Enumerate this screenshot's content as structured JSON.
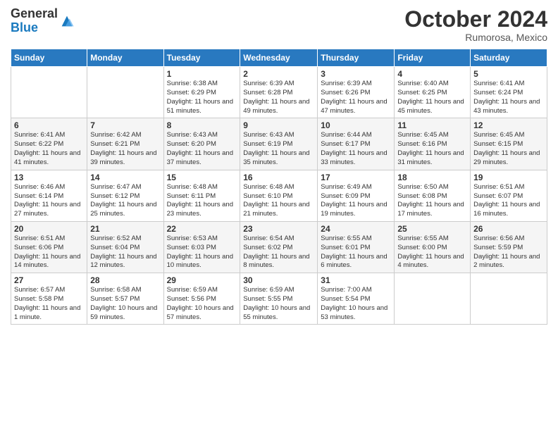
{
  "logo": {
    "general": "General",
    "blue": "Blue"
  },
  "title": "October 2024",
  "subtitle": "Rumorosa, Mexico",
  "days_of_week": [
    "Sunday",
    "Monday",
    "Tuesday",
    "Wednesday",
    "Thursday",
    "Friday",
    "Saturday"
  ],
  "weeks": [
    [
      {
        "day": "",
        "info": ""
      },
      {
        "day": "",
        "info": ""
      },
      {
        "day": "1",
        "info": "Sunrise: 6:38 AM\nSunset: 6:29 PM\nDaylight: 11 hours and 51 minutes."
      },
      {
        "day": "2",
        "info": "Sunrise: 6:39 AM\nSunset: 6:28 PM\nDaylight: 11 hours and 49 minutes."
      },
      {
        "day": "3",
        "info": "Sunrise: 6:39 AM\nSunset: 6:26 PM\nDaylight: 11 hours and 47 minutes."
      },
      {
        "day": "4",
        "info": "Sunrise: 6:40 AM\nSunset: 6:25 PM\nDaylight: 11 hours and 45 minutes."
      },
      {
        "day": "5",
        "info": "Sunrise: 6:41 AM\nSunset: 6:24 PM\nDaylight: 11 hours and 43 minutes."
      }
    ],
    [
      {
        "day": "6",
        "info": "Sunrise: 6:41 AM\nSunset: 6:22 PM\nDaylight: 11 hours and 41 minutes."
      },
      {
        "day": "7",
        "info": "Sunrise: 6:42 AM\nSunset: 6:21 PM\nDaylight: 11 hours and 39 minutes."
      },
      {
        "day": "8",
        "info": "Sunrise: 6:43 AM\nSunset: 6:20 PM\nDaylight: 11 hours and 37 minutes."
      },
      {
        "day": "9",
        "info": "Sunrise: 6:43 AM\nSunset: 6:19 PM\nDaylight: 11 hours and 35 minutes."
      },
      {
        "day": "10",
        "info": "Sunrise: 6:44 AM\nSunset: 6:17 PM\nDaylight: 11 hours and 33 minutes."
      },
      {
        "day": "11",
        "info": "Sunrise: 6:45 AM\nSunset: 6:16 PM\nDaylight: 11 hours and 31 minutes."
      },
      {
        "day": "12",
        "info": "Sunrise: 6:45 AM\nSunset: 6:15 PM\nDaylight: 11 hours and 29 minutes."
      }
    ],
    [
      {
        "day": "13",
        "info": "Sunrise: 6:46 AM\nSunset: 6:14 PM\nDaylight: 11 hours and 27 minutes."
      },
      {
        "day": "14",
        "info": "Sunrise: 6:47 AM\nSunset: 6:12 PM\nDaylight: 11 hours and 25 minutes."
      },
      {
        "day": "15",
        "info": "Sunrise: 6:48 AM\nSunset: 6:11 PM\nDaylight: 11 hours and 23 minutes."
      },
      {
        "day": "16",
        "info": "Sunrise: 6:48 AM\nSunset: 6:10 PM\nDaylight: 11 hours and 21 minutes."
      },
      {
        "day": "17",
        "info": "Sunrise: 6:49 AM\nSunset: 6:09 PM\nDaylight: 11 hours and 19 minutes."
      },
      {
        "day": "18",
        "info": "Sunrise: 6:50 AM\nSunset: 6:08 PM\nDaylight: 11 hours and 17 minutes."
      },
      {
        "day": "19",
        "info": "Sunrise: 6:51 AM\nSunset: 6:07 PM\nDaylight: 11 hours and 16 minutes."
      }
    ],
    [
      {
        "day": "20",
        "info": "Sunrise: 6:51 AM\nSunset: 6:06 PM\nDaylight: 11 hours and 14 minutes."
      },
      {
        "day": "21",
        "info": "Sunrise: 6:52 AM\nSunset: 6:04 PM\nDaylight: 11 hours and 12 minutes."
      },
      {
        "day": "22",
        "info": "Sunrise: 6:53 AM\nSunset: 6:03 PM\nDaylight: 11 hours and 10 minutes."
      },
      {
        "day": "23",
        "info": "Sunrise: 6:54 AM\nSunset: 6:02 PM\nDaylight: 11 hours and 8 minutes."
      },
      {
        "day": "24",
        "info": "Sunrise: 6:55 AM\nSunset: 6:01 PM\nDaylight: 11 hours and 6 minutes."
      },
      {
        "day": "25",
        "info": "Sunrise: 6:55 AM\nSunset: 6:00 PM\nDaylight: 11 hours and 4 minutes."
      },
      {
        "day": "26",
        "info": "Sunrise: 6:56 AM\nSunset: 5:59 PM\nDaylight: 11 hours and 2 minutes."
      }
    ],
    [
      {
        "day": "27",
        "info": "Sunrise: 6:57 AM\nSunset: 5:58 PM\nDaylight: 11 hours and 1 minute."
      },
      {
        "day": "28",
        "info": "Sunrise: 6:58 AM\nSunset: 5:57 PM\nDaylight: 10 hours and 59 minutes."
      },
      {
        "day": "29",
        "info": "Sunrise: 6:59 AM\nSunset: 5:56 PM\nDaylight: 10 hours and 57 minutes."
      },
      {
        "day": "30",
        "info": "Sunrise: 6:59 AM\nSunset: 5:55 PM\nDaylight: 10 hours and 55 minutes."
      },
      {
        "day": "31",
        "info": "Sunrise: 7:00 AM\nSunset: 5:54 PM\nDaylight: 10 hours and 53 minutes."
      },
      {
        "day": "",
        "info": ""
      },
      {
        "day": "",
        "info": ""
      }
    ]
  ]
}
